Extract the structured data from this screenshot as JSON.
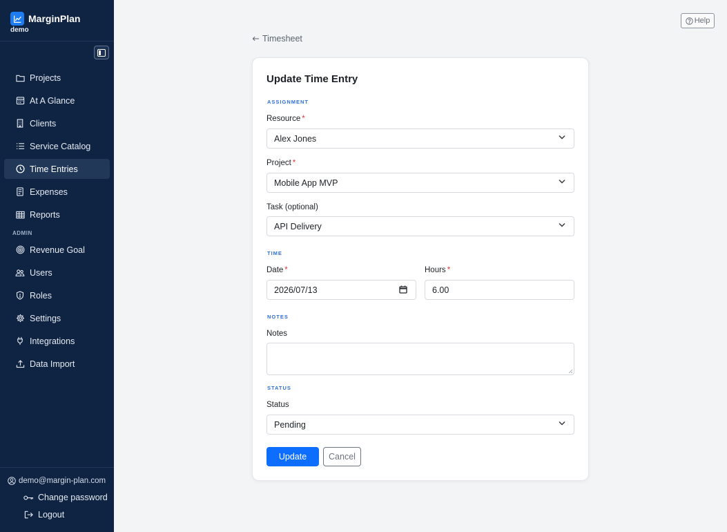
{
  "brand": {
    "name": "MarginPlan",
    "sub": "demo"
  },
  "sidebar": {
    "items": [
      {
        "label": "Projects",
        "icon": "folder-icon"
      },
      {
        "label": "At A Glance",
        "icon": "calendar-icon"
      },
      {
        "label": "Clients",
        "icon": "building-icon"
      },
      {
        "label": "Service Catalog",
        "icon": "list-icon"
      },
      {
        "label": "Time Entries",
        "icon": "clock-icon",
        "active": true
      },
      {
        "label": "Expenses",
        "icon": "receipt-icon"
      },
      {
        "label": "Reports",
        "icon": "table-icon"
      }
    ],
    "admin_label": "ADMIN",
    "admin_items": [
      {
        "label": "Revenue Goal",
        "icon": "target-icon"
      },
      {
        "label": "Users",
        "icon": "users-icon"
      },
      {
        "label": "Roles",
        "icon": "shield-icon"
      },
      {
        "label": "Settings",
        "icon": "gear-icon"
      },
      {
        "label": "Integrations",
        "icon": "plug-icon"
      },
      {
        "label": "Data Import",
        "icon": "upload-icon"
      }
    ],
    "user_email": "demo@margin-plan.com",
    "change_password": "Change password",
    "logout": "Logout"
  },
  "header": {
    "help": "Help",
    "back_link": "Timesheet"
  },
  "form": {
    "title": "Update Time Entry",
    "sections": {
      "assignment": "ASSIGNMENT",
      "time": "TIME",
      "notes": "NOTES",
      "status": "STATUS"
    },
    "resource": {
      "label": "Resource",
      "value": "Alex Jones"
    },
    "project": {
      "label": "Project",
      "value": "Mobile App MVP"
    },
    "task": {
      "label": "Task (optional)",
      "value": "API Delivery"
    },
    "date": {
      "label": "Date",
      "value": "2026/07/13"
    },
    "hours": {
      "label": "Hours",
      "value": "6.00"
    },
    "notes": {
      "label": "Notes",
      "value": ""
    },
    "status": {
      "label": "Status",
      "value": "Pending"
    },
    "required_mark": "*",
    "update_button": "Update",
    "cancel_button": "Cancel"
  },
  "colors": {
    "sidebar_bg": "#0f2342",
    "primary": "#0d6efd",
    "section": "#2f6fd6",
    "required": "#d9383a"
  }
}
